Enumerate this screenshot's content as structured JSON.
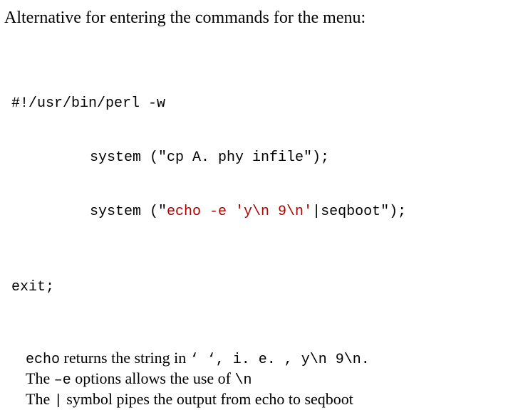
{
  "title": "Alternative for entering the commands for the menu:",
  "code": {
    "shebang": "#!/usr/bin/perl -w",
    "line2_pre": "system (\"cp A. phy infile\");",
    "line3_pre": "system (\"",
    "line3_echo": "echo -e 'y\\n 9\\n'",
    "line3_post": "|seqboot\");",
    "exit": "exit;"
  },
  "desc": {
    "p1_echo": "echo",
    "p1_a": " returns the string in ",
    "p1_q": "‘ ‘, i. e. , y\\n 9\\n.",
    "p2_a": "The ",
    "p2_flag": "–e",
    "p2_b": " options allows the use of ",
    "p2_nl": "\\n",
    "p3_a": " The ",
    "p3_pipe": "|",
    "p3_b": " symbol pipes the output from echo to seqboot"
  }
}
